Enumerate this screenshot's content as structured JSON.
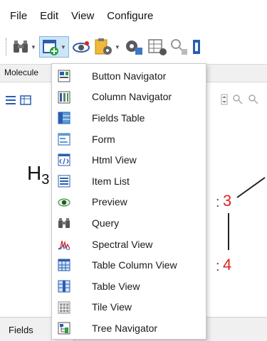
{
  "menubar": {
    "items": [
      "File",
      "Edit",
      "View",
      "Configure"
    ]
  },
  "tabstrip": {
    "tab_label": "Molecule"
  },
  "canvas": {
    "atom_h": "H",
    "atom_h_sub": "3",
    "atom_label_3": "3",
    "atom_label_4": "4",
    "colon": ":",
    "label_color": "#dd2222"
  },
  "bottombar": {
    "tab_label": "Fields"
  },
  "dropdown": {
    "items": [
      {
        "label": "Button Navigator",
        "icon": "button-navigator-icon"
      },
      {
        "label": "Column Navigator",
        "icon": "column-navigator-icon"
      },
      {
        "label": "Fields Table",
        "icon": "fields-table-icon"
      },
      {
        "label": "Form",
        "icon": "form-icon"
      },
      {
        "label": "Html View",
        "icon": "html-view-icon"
      },
      {
        "label": "Item List",
        "icon": "item-list-icon"
      },
      {
        "label": "Preview",
        "icon": "preview-eye-icon"
      },
      {
        "label": "Query",
        "icon": "binoculars-icon"
      },
      {
        "label": "Spectral View",
        "icon": "spectral-view-icon"
      },
      {
        "label": "Table Column View",
        "icon": "table-column-view-icon"
      },
      {
        "label": "Table View",
        "icon": "table-view-icon"
      },
      {
        "label": "Tile View",
        "icon": "tile-view-icon"
      },
      {
        "label": "Tree Navigator",
        "icon": "tree-navigator-icon"
      }
    ]
  },
  "colors": {
    "accent_blue": "#2a5db0",
    "selection_bg": "#cde6f7",
    "selection_border": "#7fb5dc",
    "atom_red": "#dd2222"
  }
}
